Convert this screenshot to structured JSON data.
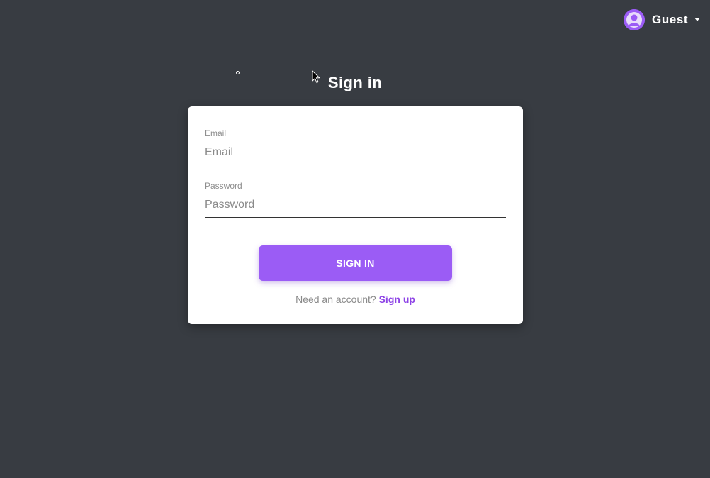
{
  "header": {
    "user_name": "Guest",
    "avatar_icon": "user-avatar-icon",
    "dropdown_icon": "caret-down-icon"
  },
  "page": {
    "title": "Sign in"
  },
  "form": {
    "email": {
      "label": "Email",
      "placeholder": "Email",
      "value": ""
    },
    "password": {
      "label": "Password",
      "placeholder": "Password",
      "value": ""
    },
    "submit_label": "SIGN IN",
    "signup_prompt": "Need an account?",
    "signup_link": "Sign up"
  },
  "colors": {
    "background": "#383c42",
    "accent": "#9b5cf5",
    "link": "#8e44e6",
    "card": "#ffffff"
  }
}
